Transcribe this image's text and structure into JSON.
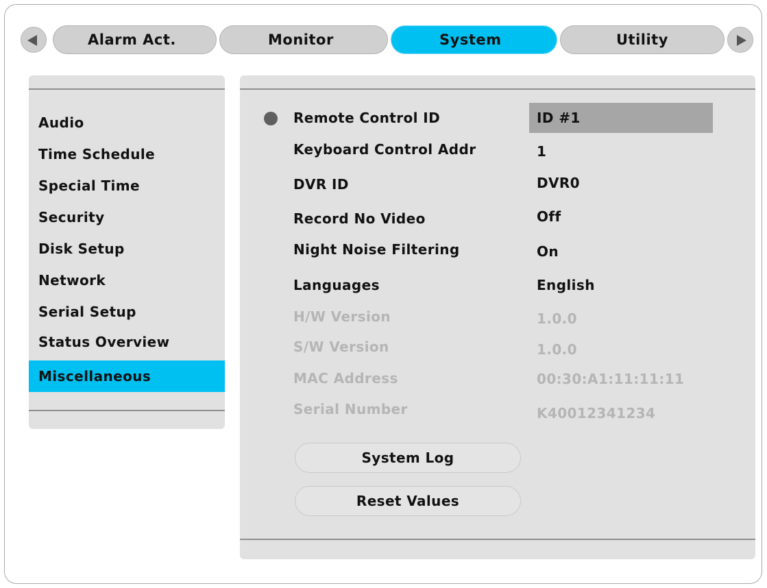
{
  "tabs": {
    "prev_label": "",
    "next_label": "",
    "items": [
      {
        "label": "Alarm Act."
      },
      {
        "label": "Monitor"
      },
      {
        "label": "System"
      },
      {
        "label": "Utility"
      }
    ],
    "active": "System"
  },
  "sidebar": {
    "items": [
      {
        "label": "Audio"
      },
      {
        "label": "Time Schedule"
      },
      {
        "label": "Special Time"
      },
      {
        "label": "Security"
      },
      {
        "label": "Disk Setup"
      },
      {
        "label": "Network"
      },
      {
        "label": "Serial Setup"
      },
      {
        "label": "Status Overview"
      },
      {
        "label": "Miscellaneous"
      }
    ],
    "active": "Miscellaneous"
  },
  "settings": {
    "remote_control_id": {
      "label": "Remote Control ID",
      "value": "ID #1"
    },
    "keyboard_control_addr": {
      "label": "Keyboard Control Addr",
      "value": "1"
    },
    "dvr_id": {
      "label": "DVR ID",
      "value": "DVR0"
    },
    "record_no_video": {
      "label": "Record No Video",
      "value": "Off"
    },
    "night_noise_filtering": {
      "label": "Night Noise Filtering",
      "value": "On"
    },
    "languages": {
      "label": "Languages",
      "value": "English"
    },
    "hw_version": {
      "label": "H/W Version",
      "value": "1.0.0"
    },
    "sw_version": {
      "label": "S/W Version",
      "value": "1.0.0"
    },
    "mac_address": {
      "label": "MAC Address",
      "value": "00:30:A1:11:11:11"
    },
    "serial_number": {
      "label": "Serial Number",
      "value": "K40012341234"
    }
  },
  "buttons": {
    "system_log": "System Log",
    "reset_values": "Reset Values"
  },
  "colors": {
    "accent": "#00c0f2",
    "panel": "#e1e1e1",
    "selection": "#a6a6a6",
    "disabled_text": "#b5b5b5"
  }
}
